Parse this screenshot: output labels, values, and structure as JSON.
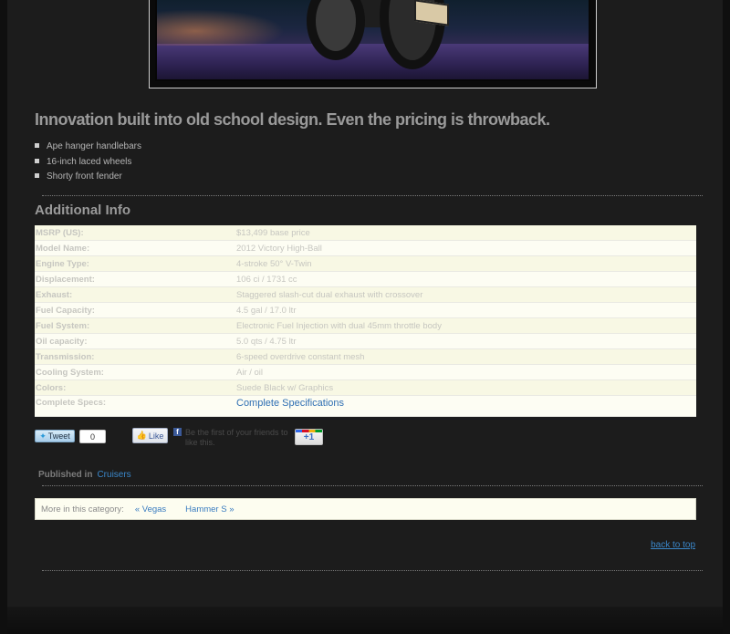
{
  "headline": "Innovation built into old school design. Even the pricing is throwback.",
  "features": [
    "Ape hanger handlebars",
    "16-inch laced wheels",
    "Shorty front fender"
  ],
  "section_title": "Additional Info",
  "specs": [
    {
      "label": "MSRP (US):",
      "value": "$13,499 base price"
    },
    {
      "label": "Model Name:",
      "value": "2012 Victory High-Ball"
    },
    {
      "label": "Engine Type:",
      "value": "4-stroke 50° V-Twin"
    },
    {
      "label": "Displacement:",
      "value": "106 ci / 1731 cc"
    },
    {
      "label": "Exhaust:",
      "value": "Staggered slash-cut dual exhaust with crossover"
    },
    {
      "label": "Fuel Capacity:",
      "value": "4.5 gal / 17.0 ltr"
    },
    {
      "label": "Fuel System:",
      "value": "Electronic Fuel Injection with dual 45mm throttle body"
    },
    {
      "label": "Oil capacity:",
      "value": "5.0 qts / 4.75 ltr"
    },
    {
      "label": "Transmission:",
      "value": "6-speed overdrive constant mesh"
    },
    {
      "label": "Cooling System:",
      "value": "Air / oil"
    },
    {
      "label": "Colors:",
      "value": "Suede Black w/ Graphics"
    }
  ],
  "complete_specs": {
    "label": "Complete Specs:",
    "link_text": "Complete Specifications"
  },
  "social": {
    "tweet_label": "Tweet",
    "tweet_count": "0",
    "like_label": "Like",
    "like_text": "Be the first of your friends to like this.",
    "plusone_label": "+1"
  },
  "published": {
    "prefix": "Published in",
    "category": "Cruisers"
  },
  "more": {
    "prefix": "More in this category:",
    "prev": "« Vegas",
    "next": "Hammer S »"
  },
  "back_to_top": "back to top"
}
